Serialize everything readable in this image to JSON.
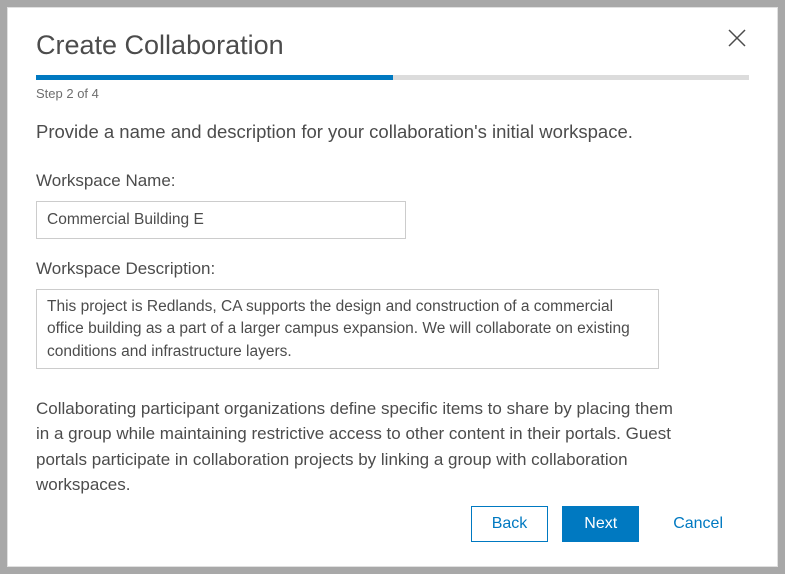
{
  "dialog": {
    "title": "Create Collaboration",
    "step_label": "Step 2 of 4",
    "progress_percent": 50,
    "instruction": "Provide a name and description for your collaboration's initial workspace."
  },
  "fields": {
    "name_label": "Workspace Name:",
    "name_value": "Commercial Building E",
    "desc_label": "Workspace Description:",
    "desc_value": "This project is Redlands, CA supports the design and construction of a commercial office building as a part of a larger campus expansion. We will collaborate on existing conditions and infrastructure layers."
  },
  "info_text": "Collaborating participant organizations define specific items to share by placing them in a group while maintaining restrictive access to other content in their portals. Guest portals participate in collaboration projects by linking a group with collaboration workspaces.",
  "buttons": {
    "back": "Back",
    "next": "Next",
    "cancel": "Cancel"
  }
}
